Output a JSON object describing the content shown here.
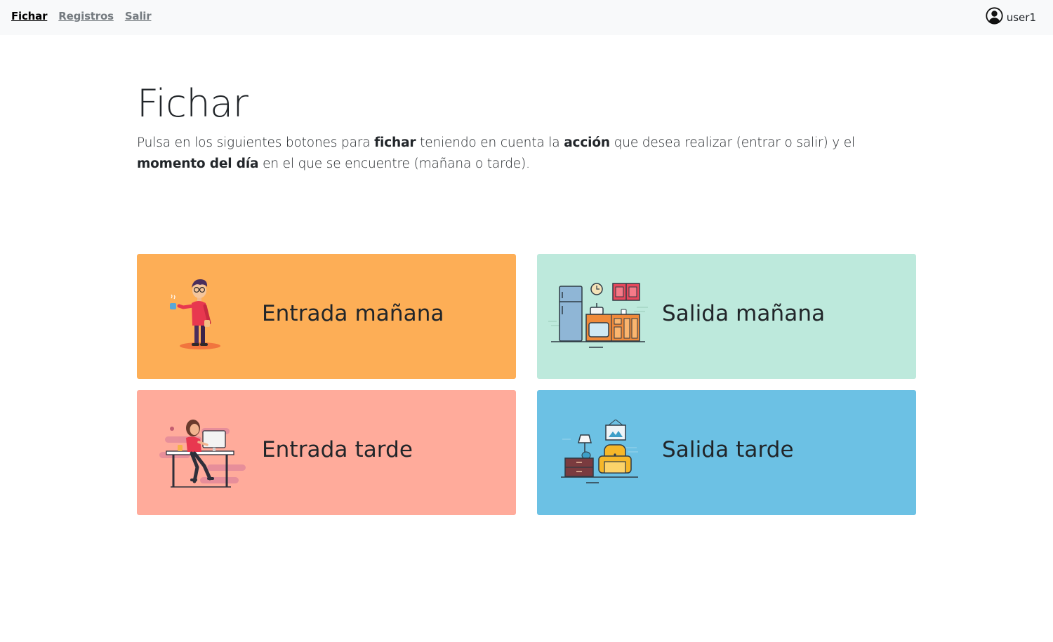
{
  "nav": {
    "links": [
      {
        "label": "Fichar"
      },
      {
        "label": "Registros"
      },
      {
        "label": "Salir"
      }
    ],
    "user": {
      "name": "user1",
      "icon": "user-circle-icon"
    }
  },
  "main": {
    "title": "Fichar",
    "lead": {
      "p1": "Pulsa en los siguientes botones para ",
      "b1": "fichar",
      "p2": " teniendo en cuenta la ",
      "b2": "acción",
      "p3": " que desea realizar (entrar o salir) y el ",
      "b3": "momento del día",
      "p4": " en el que se encuentre (mañana o tarde)."
    },
    "cards": [
      {
        "label": "Entrada mañana",
        "color": "#fdae56",
        "icon": "man-with-coffee-illustration"
      },
      {
        "label": "Salida mañana",
        "color": "#bde9dc",
        "icon": "kitchen-illustration"
      },
      {
        "label": "Entrada tarde",
        "color": "#ffab9b",
        "icon": "woman-at-desk-illustration"
      },
      {
        "label": "Salida tarde",
        "color": "#6cc1e4",
        "icon": "living-room-illustration"
      }
    ]
  }
}
